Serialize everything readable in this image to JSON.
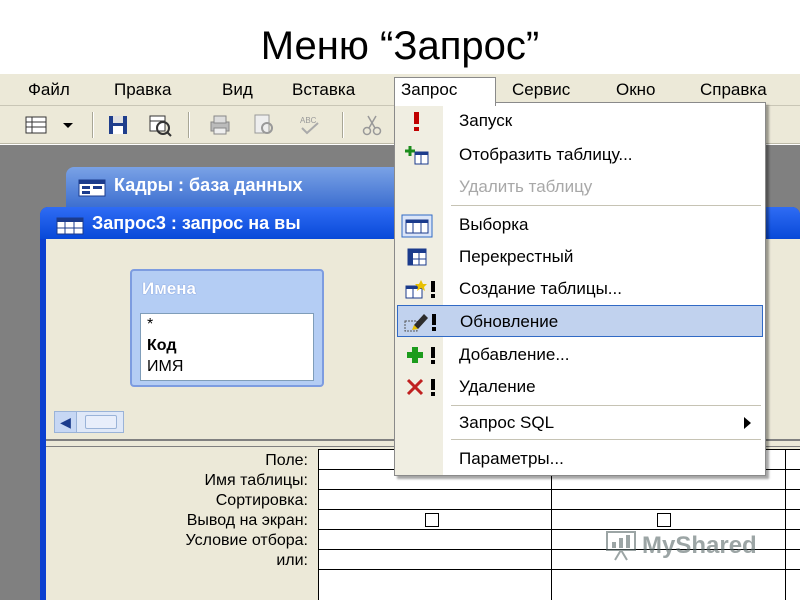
{
  "slide": {
    "title": "Меню “Запрос”"
  },
  "menubar": {
    "items": [
      {
        "label": "Файл"
      },
      {
        "label": "Правка"
      },
      {
        "label": "Вид"
      },
      {
        "label": "Вставка"
      },
      {
        "label": "Запрос"
      },
      {
        "label": "Сервис"
      },
      {
        "label": "Окно"
      },
      {
        "label": "Справка"
      }
    ],
    "active": "Запрос"
  },
  "db_window": {
    "title": "Кадры : база данных"
  },
  "query_window": {
    "title": "Запрос3 : запрос на вы",
    "table_box": {
      "name": "Имена",
      "fields": [
        "*",
        "Код",
        "ИМЯ"
      ]
    }
  },
  "grid": {
    "row_labels": [
      "Поле:",
      "Имя таблицы:",
      "Сортировка:",
      "Вывод на экран:",
      "Условие отбора:",
      "или:"
    ]
  },
  "query_menu": {
    "items": [
      {
        "label": "Запуск",
        "icon": "exclamation-icon",
        "disabled": false
      },
      {
        "label": "Отобразить таблицу...",
        "icon": "show-table-icon",
        "disabled": false
      },
      {
        "label": "Удалить таблицу",
        "icon": "",
        "disabled": true
      },
      {
        "label": "Выборка",
        "icon": "select-query-icon",
        "disabled": false
      },
      {
        "label": "Перекрестный",
        "icon": "crosstab-icon",
        "disabled": false
      },
      {
        "label": "Создание таблицы...",
        "icon": "make-table-icon",
        "disabled": false
      },
      {
        "label": "Обновление",
        "icon": "update-query-icon",
        "disabled": false,
        "highlighted": true
      },
      {
        "label": "Добавление...",
        "icon": "append-query-icon",
        "disabled": false
      },
      {
        "label": "Удаление",
        "icon": "delete-query-icon",
        "disabled": false
      },
      {
        "label": "Запрос SQL",
        "icon": "",
        "disabled": false,
        "submenu": true
      },
      {
        "label": "Параметры...",
        "icon": "",
        "disabled": false
      }
    ]
  },
  "watermark": {
    "text": "MyShared"
  },
  "colors": {
    "menu_highlight": "#c1d2ee",
    "highlight_border": "#316ac5",
    "title_bar": "#0849d8",
    "table_header": "#b4cdf4"
  }
}
